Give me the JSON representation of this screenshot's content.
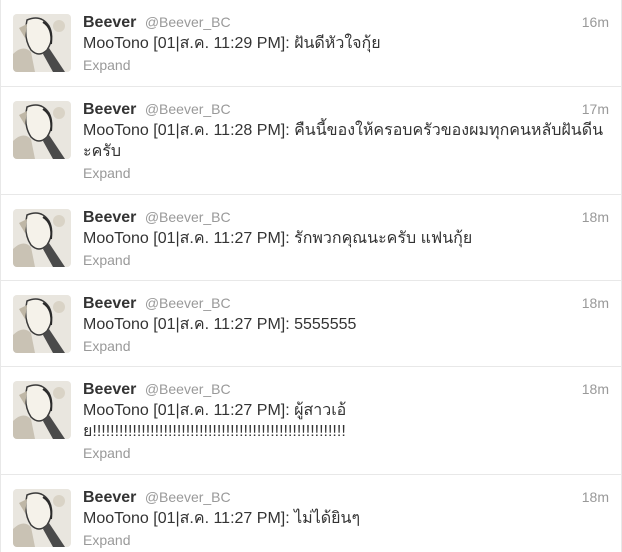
{
  "tweets": [
    {
      "fullname": "Beever",
      "username": "@Beever_BC",
      "time": "16m",
      "text": "MooTono [01|ส.ค. 11:29 PM]: ฝันดีหัวใจกุ้ย",
      "expand": "Expand",
      "avatar": "avatar-image"
    },
    {
      "fullname": "Beever",
      "username": "@Beever_BC",
      "time": "17m",
      "text": "MooTono [01|ส.ค. 11:28 PM]: คืนนี้ของให้ครอบครัวของผมทุกคนหลับฝันดีนะครับ",
      "expand": "Expand",
      "avatar": "avatar-image"
    },
    {
      "fullname": "Beever",
      "username": "@Beever_BC",
      "time": "18m",
      "text": "MooTono [01|ส.ค. 11:27 PM]: รักพวกคุณนะครับ แฟนกุ้ย",
      "expand": "Expand",
      "avatar": "avatar-image"
    },
    {
      "fullname": "Beever",
      "username": "@Beever_BC",
      "time": "18m",
      "text": "MooTono [01|ส.ค. 11:27 PM]: 5555555",
      "expand": "Expand",
      "avatar": "avatar-image"
    },
    {
      "fullname": "Beever",
      "username": "@Beever_BC",
      "time": "18m",
      "text": "MooTono [01|ส.ค. 11:27 PM]: ผู้สาวเอ้ย!!!!!!!!!!!!!!!!!!!!!!!!!!!!!!!!!!!!!!!!!!!!!!!!!!!!!!!!!",
      "expand": "Expand",
      "avatar": "avatar-image"
    },
    {
      "fullname": "Beever",
      "username": "@Beever_BC",
      "time": "18m",
      "text": "MooTono [01|ส.ค. 11:27 PM]: ไม่ได้ยินๆ",
      "expand": "Expand",
      "avatar": "avatar-image"
    }
  ],
  "colors": {
    "name": "#333333",
    "meta": "#999999",
    "border": "#e8e8e8"
  }
}
